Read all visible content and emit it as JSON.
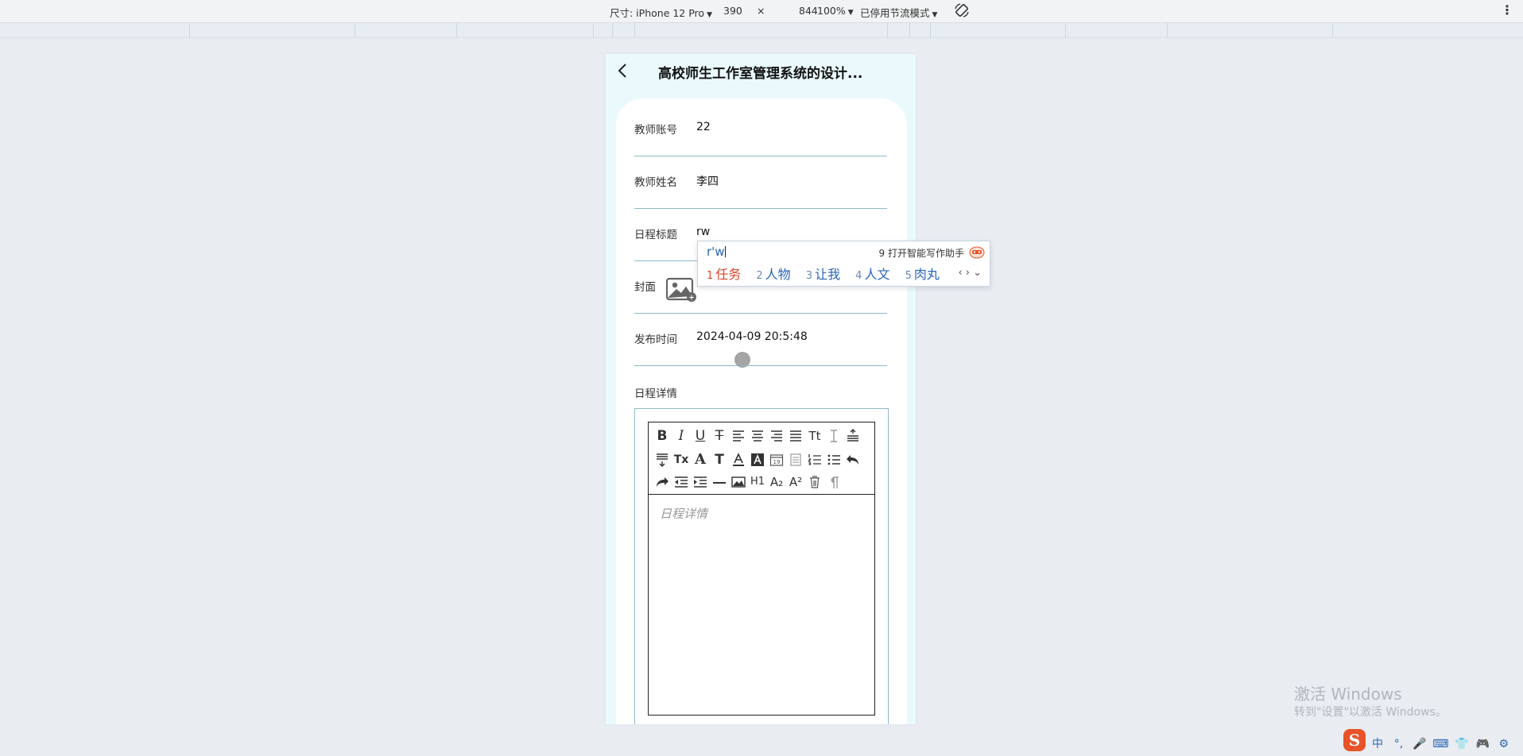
{
  "devtools": {
    "device_label": "尺寸: iPhone 12 Pro",
    "width": "390",
    "times": "×",
    "height": "844",
    "zoom": "100%",
    "throttle": "已停用节流模式"
  },
  "phone": {
    "title": "高校师生工作室管理系统的设计...",
    "form": {
      "teacher_account_label": "教师账号",
      "teacher_account_value": "22",
      "teacher_name_label": "教师姓名",
      "teacher_name_value": "李四",
      "schedule_title_label": "日程标题",
      "schedule_title_value": "rw",
      "cover_label": "封面",
      "publish_time_label": "发布时间",
      "publish_time_value": "2024-04-09 20:5:48",
      "detail_label": "日程详情",
      "detail_placeholder": "日程详情"
    },
    "toolbar_labels": {
      "bold": "B",
      "italic": "I",
      "underline": "U",
      "strike": "T",
      "font_size": "Tt",
      "clear": "Tx",
      "font": "A",
      "font_t": "T",
      "h1": "H1",
      "sub": "A₂",
      "sup": "A²"
    }
  },
  "ime": {
    "input": "r'w",
    "assist_num": "9",
    "assist_label": "打开智能写作助手",
    "candidates": [
      {
        "num": "1",
        "text": "任务"
      },
      {
        "num": "2",
        "text": "人物"
      },
      {
        "num": "3",
        "text": "让我"
      },
      {
        "num": "4",
        "text": "人文"
      },
      {
        "num": "5",
        "text": "肉丸"
      }
    ],
    "nav": "‹ › ⌄"
  },
  "watermark": {
    "line1": "激活 Windows",
    "line2": "转到\"设置\"以激活 Windows。"
  },
  "tray": {
    "logo": "S",
    "lang": "中",
    "punct": "°,",
    "icons": [
      "mic-icon",
      "keyboard-icon",
      "shirt-icon",
      "gamepad-icon",
      "gear-icon"
    ]
  }
}
